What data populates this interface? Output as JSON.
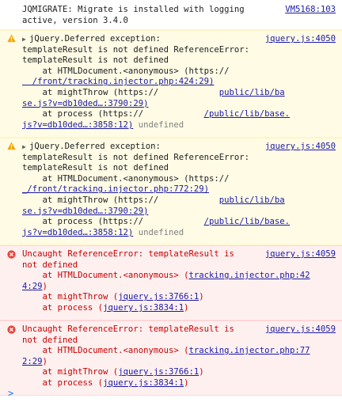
{
  "info": {
    "line1": "JQMIGRATE: Migrate is installed with logging",
    "line2": "active, version 3.4.0",
    "source": "VM5168:103"
  },
  "warnings": [
    {
      "source": "jquery.js:4050",
      "lines": [
        "jQuery.Deferred exception:",
        "templateResult is not defined ReferenceError:",
        "templateResult is not defined",
        "    at HTMLDocument.<anonymous> (https://",
        "/front/tracking.injector.php:424:29)",
        "    at mightThrow (https://",
        "public/lib/ba",
        "se.js?v=db10ded…:3790:29)",
        "    at process (https://",
        "/public/lib/base.",
        "js?v=db10ded…:3858:12)",
        "undefined"
      ]
    },
    {
      "source": "jquery.js:4050",
      "lines": [
        "jQuery.Deferred exception:",
        "templateResult is not defined ReferenceError:",
        "templateResult is not defined",
        "    at HTMLDocument.<anonymous> (https://",
        "_/front/tracking.injector.php:772:29)",
        "    at mightThrow (https://",
        "public/lib/ba",
        "se.js?v=db10ded…:3790:29)",
        "    at process (https://",
        "/public/lib/base.",
        "js?v=db10ded…:3858:12)",
        "undefined"
      ]
    }
  ],
  "errors": [
    {
      "source": "jquery.js:4059",
      "title": "Uncaught ReferenceError: templateResult is",
      "title2": "not defined",
      "at1": "    at HTMLDocument.<anonymous> (",
      "link1a": "tracking.injector.php:42",
      "link1b": "4:29",
      "at2": "    at mightThrow (",
      "link2": "jquery.js:3766:1",
      "at3": "    at process (",
      "link3": "jquery.js:3834:1"
    },
    {
      "source": "jquery.js:4059",
      "title": "Uncaught ReferenceError: templateResult is",
      "title2": "not defined",
      "at1": "    at HTMLDocument.<anonymous> (",
      "link1a": "tracking.injector.php:77",
      "link1b": "2:29",
      "at2": "    at mightThrow (",
      "link2": "jquery.js:3766:1",
      "at3": "    at process (",
      "link3": "jquery.js:3834:1"
    }
  ],
  "prompt": ">"
}
